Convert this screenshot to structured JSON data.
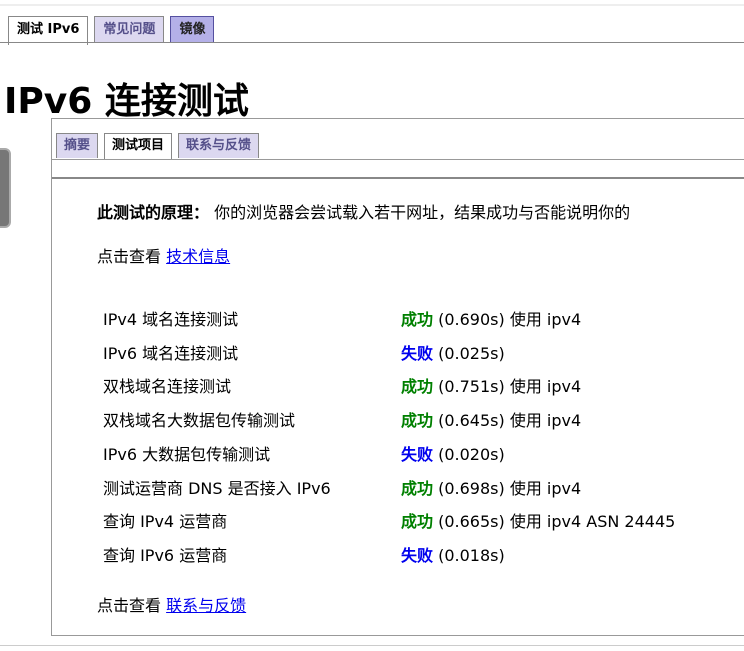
{
  "top_tabs": [
    {
      "label": "测试 IPv6"
    },
    {
      "label": "常见问题"
    },
    {
      "label": "镜像"
    }
  ],
  "title": "IPv6 连接测试",
  "inner_tabs": [
    {
      "label": "摘要"
    },
    {
      "label": "测试项目"
    },
    {
      "label": "联系与反馈"
    }
  ],
  "principle_label": "此测试的原理：",
  "principle_text": "你的浏览器会尝试载入若干网址，结果成功与否能说明你的",
  "view_prefix": "点击查看",
  "tech_link": "技术信息",
  "feedback_link": "联系与反馈",
  "tests": [
    {
      "name": "IPv4 域名连接测试",
      "status": "成功",
      "ok": true,
      "detail": "(0.690s) 使用 ipv4"
    },
    {
      "name": "IPv6 域名连接测试",
      "status": "失败",
      "ok": false,
      "detail": "(0.025s)"
    },
    {
      "name": "双栈域名连接测试",
      "status": "成功",
      "ok": true,
      "detail": "(0.751s) 使用 ipv4"
    },
    {
      "name": "双栈域名大数据包传输测试",
      "status": "成功",
      "ok": true,
      "detail": "(0.645s) 使用 ipv4"
    },
    {
      "name": "IPv6 大数据包传输测试",
      "status": "失败",
      "ok": false,
      "detail": "(0.020s)"
    },
    {
      "name": "测试运营商 DNS 是否接入 IPv6",
      "status": "成功",
      "ok": true,
      "detail": "(0.698s) 使用 ipv4"
    },
    {
      "name": "查询 IPv4 运营商",
      "status": "成功",
      "ok": true,
      "detail": "(0.665s) 使用 ipv4 ASN 24445"
    },
    {
      "name": "查询 IPv6 运营商",
      "status": "失败",
      "ok": false,
      "detail": "(0.018s)"
    }
  ]
}
